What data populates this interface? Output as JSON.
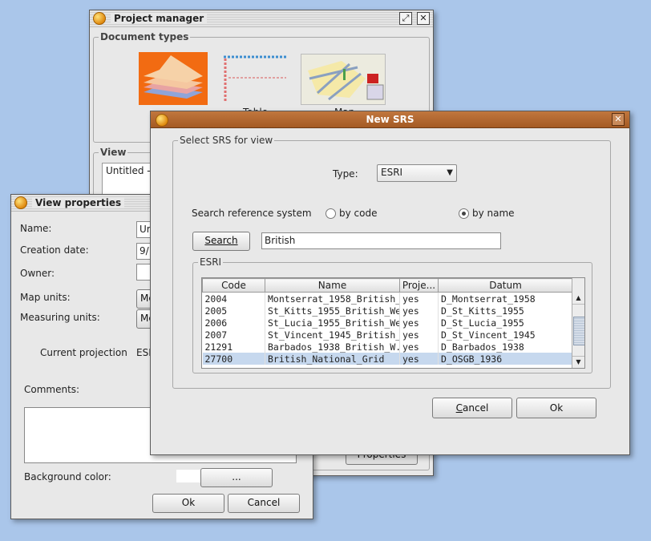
{
  "project_manager": {
    "title": "Project manager",
    "doc_types_legend": "Document types",
    "doc_type_labels": [
      "Table",
      "Map"
    ],
    "view_legend": "View",
    "view_items": [
      "Untitled - "
    ],
    "properties_button": "Properties"
  },
  "view_properties": {
    "title": "View properties",
    "name_label": "Name:",
    "name_value": "Ur",
    "creation_date_label": "Creation date:",
    "creation_date_value": "9/",
    "owner_label": "Owner:",
    "owner_value": "",
    "map_units_label": "Map units:",
    "map_units_value": "Me",
    "measuring_units_label": "Measuring units:",
    "measuring_units_value": "Me",
    "current_projection_label": "Current projection",
    "current_projection_value": "ESF",
    "comments_label": "Comments:",
    "comments_value": "",
    "background_color_label": "Background color:",
    "background_color_button": "...",
    "background_color": "#ffffff",
    "ok_button": "Ok",
    "cancel_button": "Cancel"
  },
  "new_srs": {
    "title": "New SRS",
    "select_legend": "Select SRS for view",
    "type_label": "Type:",
    "type_value": "ESRI",
    "search_label": "Search reference system",
    "by_code_label": "by code",
    "by_name_label": "by name",
    "search_mode": "by name",
    "search_button": "Search",
    "search_value": "British",
    "results_legend": "ESRI",
    "columns": [
      "Code",
      "Name",
      "Proje...",
      "Datum"
    ],
    "rows": [
      [
        "2004",
        "Montserrat_1958_British_...",
        "yes",
        "D_Montserrat_1958"
      ],
      [
        "2005",
        "St_Kitts_1955_British_West...",
        "yes",
        "D_St_Kitts_1955"
      ],
      [
        "2006",
        "St_Lucia_1955_British_Wes...",
        "yes",
        "D_St_Lucia_1955"
      ],
      [
        "2007",
        "St_Vincent_1945_British_W...",
        "yes",
        "D_St_Vincent_1945"
      ],
      [
        "21291",
        "Barbados_1938_British_W...",
        "yes",
        "D_Barbados_1938"
      ],
      [
        "27700",
        "British_National_Grid",
        "yes",
        "D_OSGB_1936"
      ]
    ],
    "selected_row": 5,
    "cancel_button": "Cancel",
    "ok_button": "Ok"
  },
  "colors": {
    "desktop": "#aac6ea",
    "dialog_title": "#b06630",
    "selection": "#c6d8ee"
  }
}
